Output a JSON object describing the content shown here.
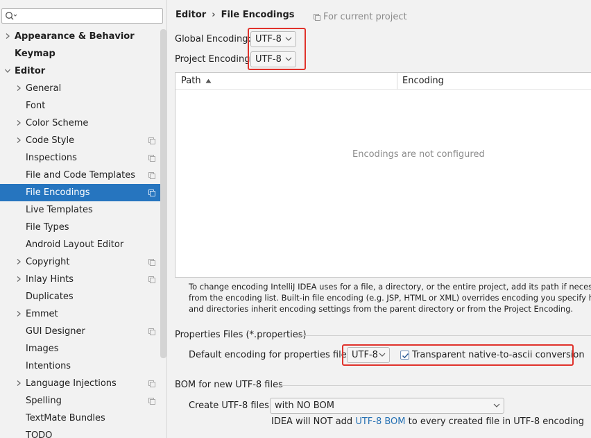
{
  "search": {
    "placeholder": ""
  },
  "sidebar": {
    "items": [
      {
        "label": "Appearance & Behavior",
        "bold": true,
        "arrow": "collapsed",
        "level": 0,
        "project": false
      },
      {
        "label": "Keymap",
        "bold": true,
        "arrow": "none",
        "level": 0,
        "project": false
      },
      {
        "label": "Editor",
        "bold": true,
        "arrow": "expanded",
        "level": 0,
        "project": false
      },
      {
        "label": "General",
        "bold": false,
        "arrow": "collapsed",
        "level": 1,
        "project": false
      },
      {
        "label": "Font",
        "bold": false,
        "arrow": "none",
        "level": 1,
        "project": false
      },
      {
        "label": "Color Scheme",
        "bold": false,
        "arrow": "collapsed",
        "level": 1,
        "project": false
      },
      {
        "label": "Code Style",
        "bold": false,
        "arrow": "collapsed",
        "level": 1,
        "project": true
      },
      {
        "label": "Inspections",
        "bold": false,
        "arrow": "none",
        "level": 1,
        "project": true
      },
      {
        "label": "File and Code Templates",
        "bold": false,
        "arrow": "none",
        "level": 1,
        "project": true
      },
      {
        "label": "File Encodings",
        "bold": false,
        "arrow": "none",
        "level": 1,
        "project": true,
        "selected": true
      },
      {
        "label": "Live Templates",
        "bold": false,
        "arrow": "none",
        "level": 1,
        "project": false
      },
      {
        "label": "File Types",
        "bold": false,
        "arrow": "none",
        "level": 1,
        "project": false
      },
      {
        "label": "Android Layout Editor",
        "bold": false,
        "arrow": "none",
        "level": 1,
        "project": false
      },
      {
        "label": "Copyright",
        "bold": false,
        "arrow": "collapsed",
        "level": 1,
        "project": true
      },
      {
        "label": "Inlay Hints",
        "bold": false,
        "arrow": "collapsed",
        "level": 1,
        "project": true
      },
      {
        "label": "Duplicates",
        "bold": false,
        "arrow": "none",
        "level": 1,
        "project": false
      },
      {
        "label": "Emmet",
        "bold": false,
        "arrow": "collapsed",
        "level": 1,
        "project": false
      },
      {
        "label": "GUI Designer",
        "bold": false,
        "arrow": "none",
        "level": 1,
        "project": true
      },
      {
        "label": "Images",
        "bold": false,
        "arrow": "none",
        "level": 1,
        "project": false
      },
      {
        "label": "Intentions",
        "bold": false,
        "arrow": "none",
        "level": 1,
        "project": false
      },
      {
        "label": "Language Injections",
        "bold": false,
        "arrow": "collapsed",
        "level": 1,
        "project": true
      },
      {
        "label": "Spelling",
        "bold": false,
        "arrow": "none",
        "level": 1,
        "project": true
      },
      {
        "label": "TextMate Bundles",
        "bold": false,
        "arrow": "none",
        "level": 1,
        "project": false
      },
      {
        "label": "TODO",
        "bold": false,
        "arrow": "none",
        "level": 1,
        "project": false
      }
    ]
  },
  "header": {
    "crumb_root": "Editor",
    "crumb_sep": "›",
    "crumb_page": "File Encodings",
    "scope_label": "For current project"
  },
  "encoding": {
    "global_label": "Global Encoding:",
    "global_value": "UTF-8",
    "project_label": "Project Encoding:",
    "project_value": "UTF-8"
  },
  "table": {
    "col_path": "Path",
    "col_encoding": "Encoding",
    "empty_text": "Encodings are not configured"
  },
  "help": {
    "line1": "To change encoding IntelliJ IDEA uses for a file, a directory, or the entire project, add its path if necessary and th",
    "line2": "from the encoding list. Built-in file encoding (e.g. JSP, HTML or XML) overrides encoding you specify here. If no",
    "line3": "and directories inherit encoding settings from the parent directory or from the Project Encoding."
  },
  "properties": {
    "section_title": "Properties Files (*.properties)",
    "default_label": "Default encoding for properties files:",
    "default_value": "UTF-8",
    "checkbox_label": "Transparent native-to-ascii conversion",
    "checkbox_checked": true
  },
  "bom": {
    "section_title": "BOM for new UTF-8 files",
    "create_label": "Create UTF-8 files:",
    "create_value": "with NO BOM",
    "note_before": "IDEA will NOT add",
    "note_link": "UTF-8 BOM",
    "note_after": "to every created file in UTF-8 encoding"
  },
  "colors": {
    "selection": "#2675bf",
    "highlight_border": "#e0322b",
    "link": "#2470b3"
  }
}
